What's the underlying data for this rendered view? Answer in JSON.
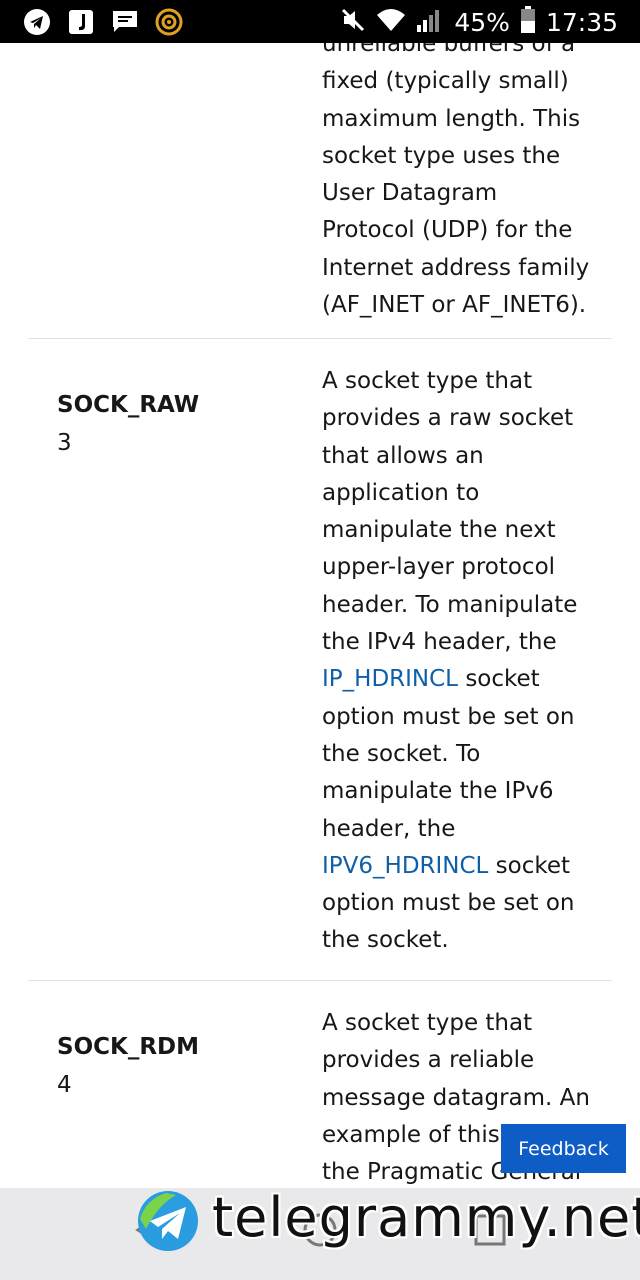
{
  "status_bar": {
    "battery": "45%",
    "time": "17:35"
  },
  "rows": [
    {
      "name": "",
      "value": "",
      "desc_lines": [
        "unreliable buffers of a",
        "fixed (typically small)",
        "maximum length. This",
        "socket type uses the",
        "User Datagram",
        "Protocol (UDP) for the",
        "Internet address family",
        "(AF_INET or AF_INET6)."
      ]
    },
    {
      "name": "SOCK_RAW",
      "value": "3",
      "desc_lines": [
        "A socket type that",
        "provides a raw socket",
        "that allows an",
        "application to",
        "manipulate the next",
        "upper-layer protocol",
        "header. To manipulate",
        "the IPv4 header, the"
      ],
      "link1": "IP_HDRINCL",
      "after_link1": " socket",
      "desc_lines_2": [
        "option must be set on",
        "the socket. To",
        "manipulate the IPv6",
        "header, the"
      ],
      "link2": "IPV6_HDRINCL",
      "after_link2": " socket",
      "desc_lines_3": [
        "option must be set on",
        "the socket."
      ]
    },
    {
      "name": "SOCK_RDM",
      "value": "4",
      "desc_lines": [
        "A socket type that",
        "provides a reliable",
        "message datagram. An",
        "example of this t",
        "the Pragmatic General"
      ]
    }
  ],
  "feedback_label": "Feedback",
  "watermark": "telegrammy.net"
}
